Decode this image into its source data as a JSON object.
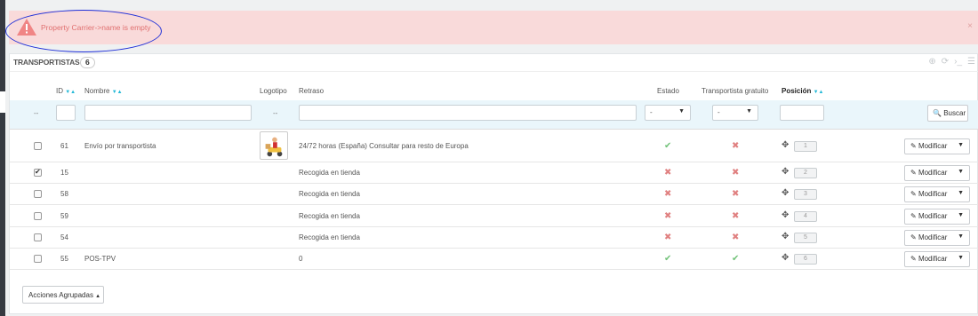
{
  "alert": {
    "message": "Property Carrier->name is empty",
    "close": "×"
  },
  "panel": {
    "title": "TRANSPORTISTAS",
    "count": "6"
  },
  "columns": {
    "id": "ID",
    "name": "Nombre",
    "logo": "Logotipo",
    "delay": "Retraso",
    "status": "Estado",
    "free": "Transportista gratuito",
    "position": "Posición"
  },
  "filters": {
    "dash": "--",
    "select_dash": "-",
    "search": "Buscar"
  },
  "rows": [
    {
      "id": "61",
      "name": "Envío por transportista",
      "delay": "24/72 horas (España) Consultar para resto de Europa",
      "status": true,
      "free": false,
      "pos": "1",
      "checked": false,
      "logo": true
    },
    {
      "id": "15",
      "name": "",
      "delay": "Recogida en tienda",
      "status": false,
      "free": false,
      "pos": "2",
      "checked": true,
      "logo": false
    },
    {
      "id": "58",
      "name": "",
      "delay": "Recogida en tienda",
      "status": false,
      "free": false,
      "pos": "3",
      "checked": false,
      "logo": false
    },
    {
      "id": "59",
      "name": "",
      "delay": "Recogida en tienda",
      "status": false,
      "free": false,
      "pos": "4",
      "checked": false,
      "logo": false
    },
    {
      "id": "54",
      "name": "",
      "delay": "Recogida en tienda",
      "status": false,
      "free": false,
      "pos": "5",
      "checked": false,
      "logo": false
    },
    {
      "id": "55",
      "name": "POS-TPV",
      "delay": "0",
      "status": true,
      "free": true,
      "pos": "6",
      "checked": false,
      "logo": false
    }
  ],
  "modify_label": "Modificar",
  "bulk_label": "Acciones Agrupadas"
}
